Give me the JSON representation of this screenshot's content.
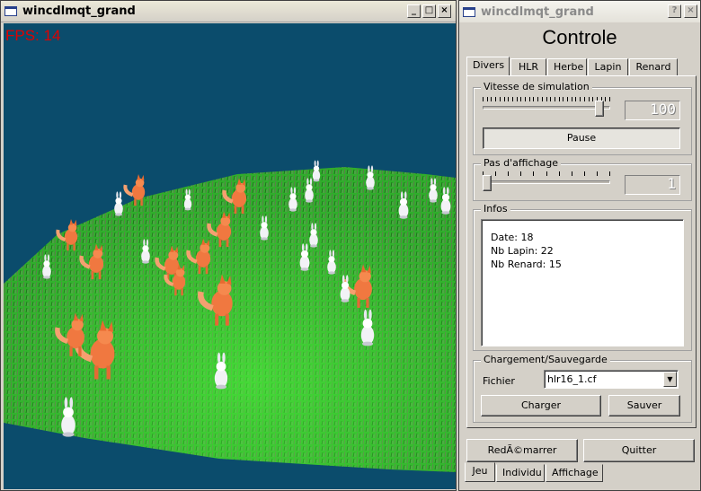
{
  "left_window": {
    "title": "wincdlmqt_grand",
    "fps_label": "FPS: 14",
    "buttons": {
      "minimize": "_",
      "maximize": "□",
      "close": "×"
    }
  },
  "right_window": {
    "title": "wincdlmqt_grand",
    "help_btn": "?",
    "close_btn": "×",
    "heading": "Controle",
    "tabs": [
      "Divers",
      "HLR",
      "Herbe",
      "Lapin",
      "Renard"
    ],
    "vitesse": {
      "legend": "Vitesse de simulation",
      "value": "100",
      "level": 0.95
    },
    "pause_label": "Pause",
    "pas": {
      "legend": "Pas d'affichage",
      "value": "1",
      "level": 0.0
    },
    "infos": {
      "legend": "Infos",
      "lines": [
        "Date: 18",
        "Nb Lapin: 22",
        "Nb Renard: 15"
      ]
    },
    "charge": {
      "legend": "Chargement/Sauvegarde",
      "file_label": "Fichier",
      "file_value": "hlr16_1.cf",
      "load_label": "Charger",
      "save_label": "Sauver"
    },
    "restart_label": "RedÃ©marrer",
    "quit_label": "Quitter",
    "bottom_tabs": [
      "Jeu",
      "Individu",
      "Affichage"
    ]
  },
  "colors": {
    "scene_bg": "#0b4c6c",
    "grass": "#2fae2b",
    "fps": "#e00000",
    "fox": "#f07840",
    "rabbit": "#f2f2f6"
  }
}
